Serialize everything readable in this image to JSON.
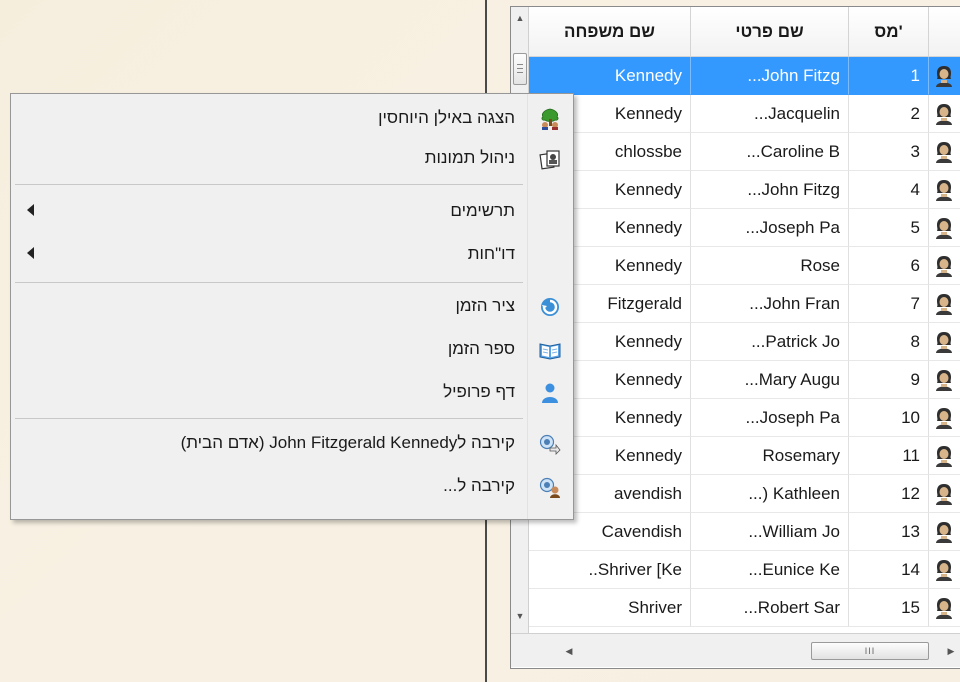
{
  "table": {
    "columns": [
      "שם משפחה",
      "שם פרטי",
      "מס'"
    ],
    "rows": [
      {
        "surname": "Kennedy",
        "given": "...John Fitzg",
        "num": "1"
      },
      {
        "surname": "Kennedy",
        "given": "...Jacquelin",
        "num": "2"
      },
      {
        "surname": "chlossbe",
        "given": "...Caroline B",
        "num": "3"
      },
      {
        "surname": "Kennedy",
        "given": "...John Fitzg",
        "num": "4"
      },
      {
        "surname": "Kennedy",
        "given": "...Joseph Pa",
        "num": "5"
      },
      {
        "surname": "Kennedy",
        "given": "Rose",
        "num": "6"
      },
      {
        "surname": "Fitzgerald",
        "given": "...John Fran",
        "num": "7"
      },
      {
        "surname": "Kennedy",
        "given": "...Patrick Jo",
        "num": "8"
      },
      {
        "surname": "Kennedy",
        "given": "...Mary Augu",
        "num": "9"
      },
      {
        "surname": "Kennedy",
        "given": "...Joseph Pa",
        "num": "10"
      },
      {
        "surname": "Kennedy",
        "given": "Rosemary",
        "num": "11"
      },
      {
        "surname": "avendish",
        "given": "...) Kathleen",
        "num": "12"
      },
      {
        "surname": "Cavendish",
        "given": "...William Jo",
        "num": "13"
      },
      {
        "surname": "..Shriver [Ke",
        "given": "...Eunice Ke",
        "num": "14"
      },
      {
        "surname": "Shriver",
        "given": "...Robert Sar",
        "num": "15"
      }
    ],
    "selected_row": 1,
    "hscroll_grip": "III"
  },
  "menu": {
    "items": [
      {
        "label": "הצגה באילן היוחסין",
        "icon": "tree-icon"
      },
      {
        "label": "ניהול תמונות",
        "icon": "photos-icon"
      },
      {
        "label": "תרשימים",
        "icon": "",
        "submenu": true
      },
      {
        "label": "דו\"חות",
        "icon": "",
        "submenu": true
      },
      {
        "label": "ציר הזמן",
        "icon": "timeline-icon"
      },
      {
        "label": "ספר הזמן",
        "icon": "book-icon"
      },
      {
        "label": "דף פרופיל",
        "icon": "person-icon"
      },
      {
        "label": "קירבה לJohn Fitzgerald Kennedy (אדם הבית)",
        "icon": "relationship-icon"
      },
      {
        "label": "קירבה ל...",
        "icon": "relationship-search-icon"
      }
    ]
  },
  "colors": {
    "selection": "#3399ff",
    "menu_bg": "#f0f0f0"
  }
}
